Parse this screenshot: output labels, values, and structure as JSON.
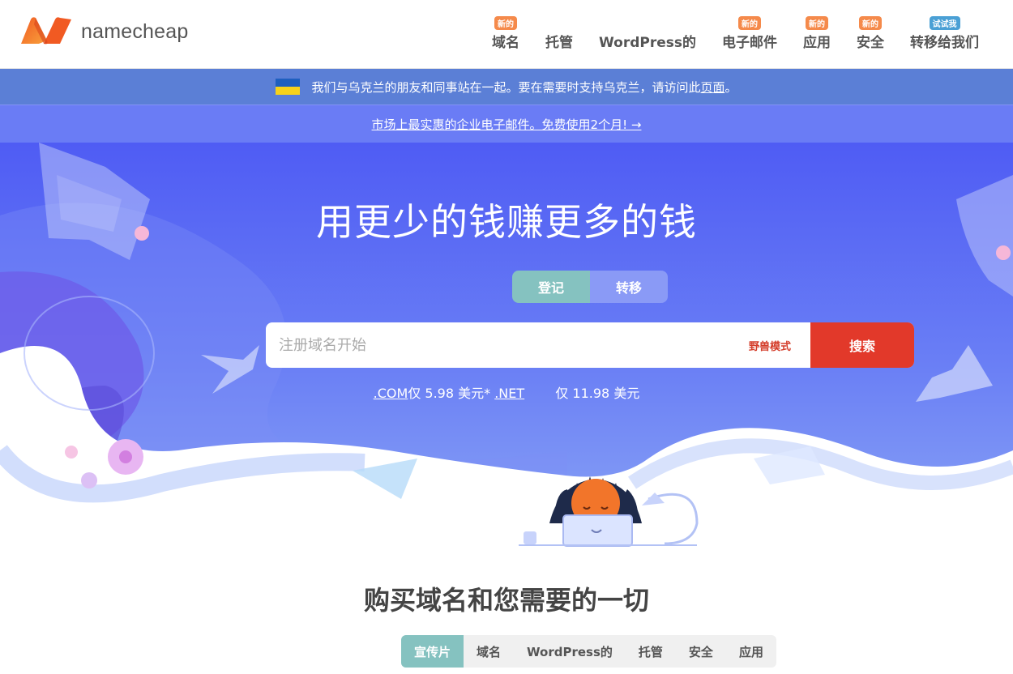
{
  "brand": {
    "name": "namecheap",
    "accent": "#f15a22",
    "accent2": "#f8a13c"
  },
  "nav": [
    {
      "label": "域名",
      "badge": "新的",
      "badge_color": "orange"
    },
    {
      "label": "托管",
      "badge": "",
      "badge_color": ""
    },
    {
      "label": "WordPress的",
      "badge": "",
      "badge_color": ""
    },
    {
      "label": "电子邮件",
      "badge": "新的",
      "badge_color": "orange"
    },
    {
      "label": "应用",
      "badge": "新的",
      "badge_color": "orange"
    },
    {
      "label": "安全",
      "badge": "新的",
      "badge_color": "orange"
    },
    {
      "label": "转移给我们",
      "badge": "试试我",
      "badge_color": "blue"
    }
  ],
  "ukraine_banner": {
    "text": "我们与乌克兰的朋友和同事站在一起。要在需要时支持乌克兰，请访问此",
    "link": "页面",
    "suffix": "。"
  },
  "promo_banner": {
    "text": "市场上最实惠的企业电子邮件。免费使用2个月! →"
  },
  "hero": {
    "title": "用更少的钱赚更多的钱",
    "tabs": [
      {
        "label": "登记",
        "active": true
      },
      {
        "label": "转移",
        "active": false
      }
    ],
    "search_placeholder": "注册域名开始",
    "beast_mode": "野兽模式",
    "search_button": "搜索",
    "pricing": {
      "com": ".COM",
      "com_price": "仅 5.98 美元*",
      "net": ".NET",
      "net_price": "仅 11.98 美元"
    }
  },
  "section": {
    "title": "购买域名和您需要的一切",
    "tabs": [
      "宣传片",
      "域名",
      "WordPress的",
      "托管",
      "安全",
      "应用"
    ]
  },
  "colors": {
    "hero_top": "#4f5cf4",
    "hero_bottom": "#8aa4f5",
    "tab_active": "#85c2c0",
    "search_button": "#e2392a",
    "ukraine_bar": "#5b7fd6",
    "promo_bar": "#6a7cf5"
  }
}
